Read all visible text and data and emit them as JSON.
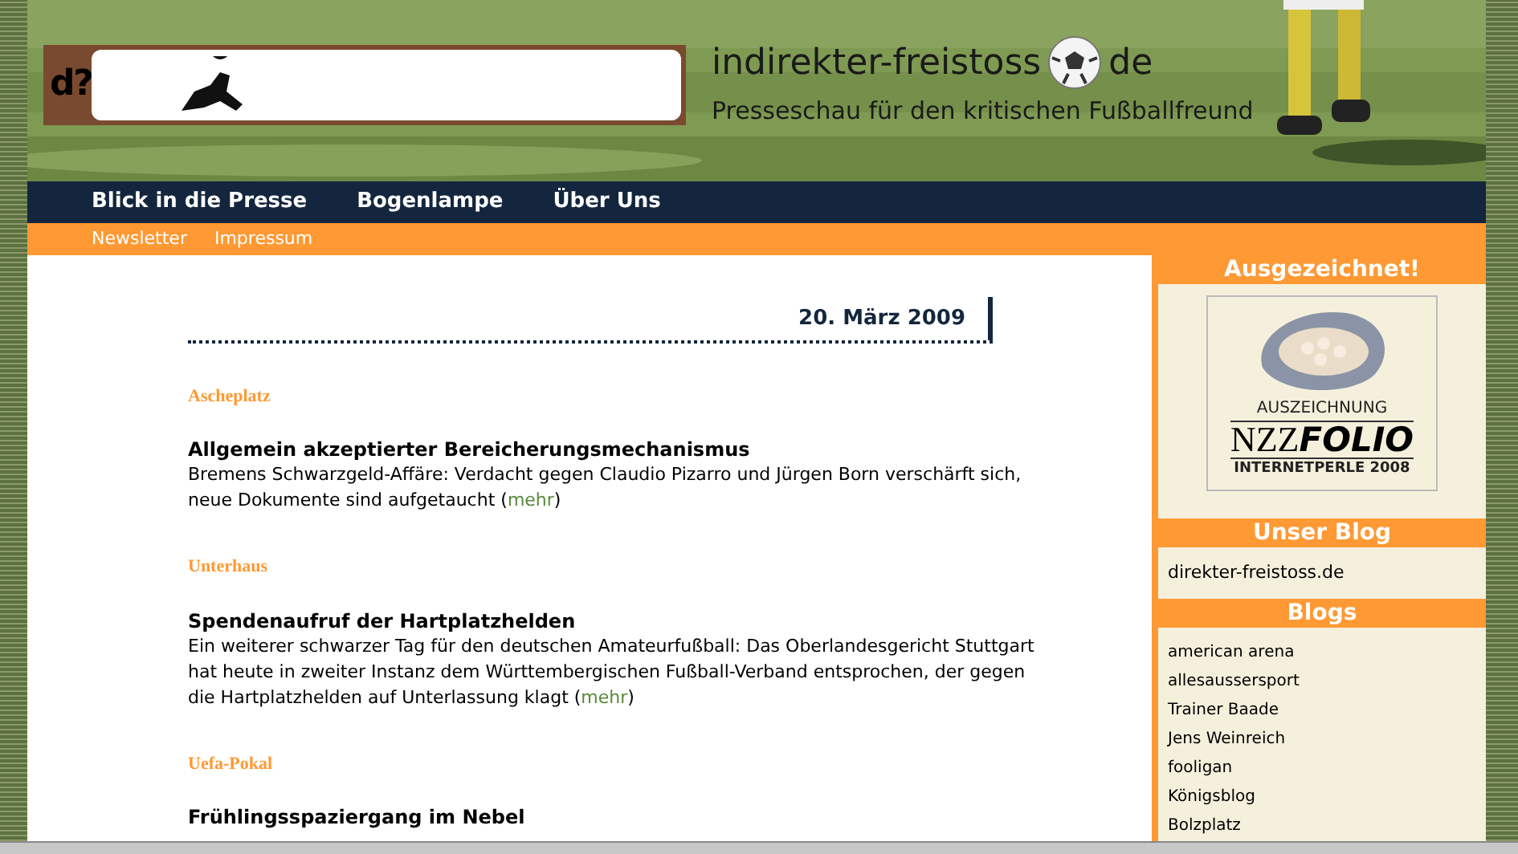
{
  "header": {
    "logo_text": "d?",
    "site_title": "indirekter-freistoss",
    "site_title_suffix": "de",
    "tagline": "Presseschau für den kritischen Fußballfreund"
  },
  "nav": [
    {
      "label": "Blick in die Presse"
    },
    {
      "label": "Bogenlampe"
    },
    {
      "label": "Über Uns"
    }
  ],
  "subnav": [
    {
      "label": "Newsletter"
    },
    {
      "label": "Impressum"
    }
  ],
  "date": "20. März 2009",
  "articles": [
    {
      "category": "Ascheplatz",
      "title": "Allgemein akzeptierter Bereicherungsmechanismus",
      "text": "Bremens Schwarzgeld-Affäre: Verdacht gegen Claudio Pizarro und Jürgen Born verschärft sich, neue Dokumente sind aufgetaucht (",
      "link": "mehr",
      "text_end": ")"
    },
    {
      "category": "Unterhaus",
      "title": "Spendenaufruf der Hartplatzhelden",
      "text": "Ein weiterer schwarzer Tag für den deutschen Amateurfußball: Das Oberlandesgericht Stuttgart hat heute in zweiter Instanz dem Württembergischen Fußball-Verband entsprochen, der gegen die Hartplatzhelden auf Unterlassung klagt (",
      "link": "mehr",
      "text_end": ")"
    },
    {
      "category": "Uefa-Pokal",
      "title": "Frühlingsspaziergang im Nebel"
    }
  ],
  "sidebar": {
    "award": {
      "heading": "Ausgezeichnet!",
      "badge_top": "AUSZEICHNUNG",
      "badge_brand": "NZZ",
      "badge_brand_bold": "FOLIO",
      "badge_bottom": "INTERNETPERLE 2008"
    },
    "our_blog": {
      "heading": "Unser Blog",
      "items": [
        "direkter-freistoss.de"
      ]
    },
    "blogs": {
      "heading": "Blogs",
      "items": [
        "american arena",
        "allesaussersport",
        "Trainer Baade",
        "Jens Weinreich",
        "fooligan",
        "Königsblog",
        "Bolzplatz"
      ]
    }
  }
}
